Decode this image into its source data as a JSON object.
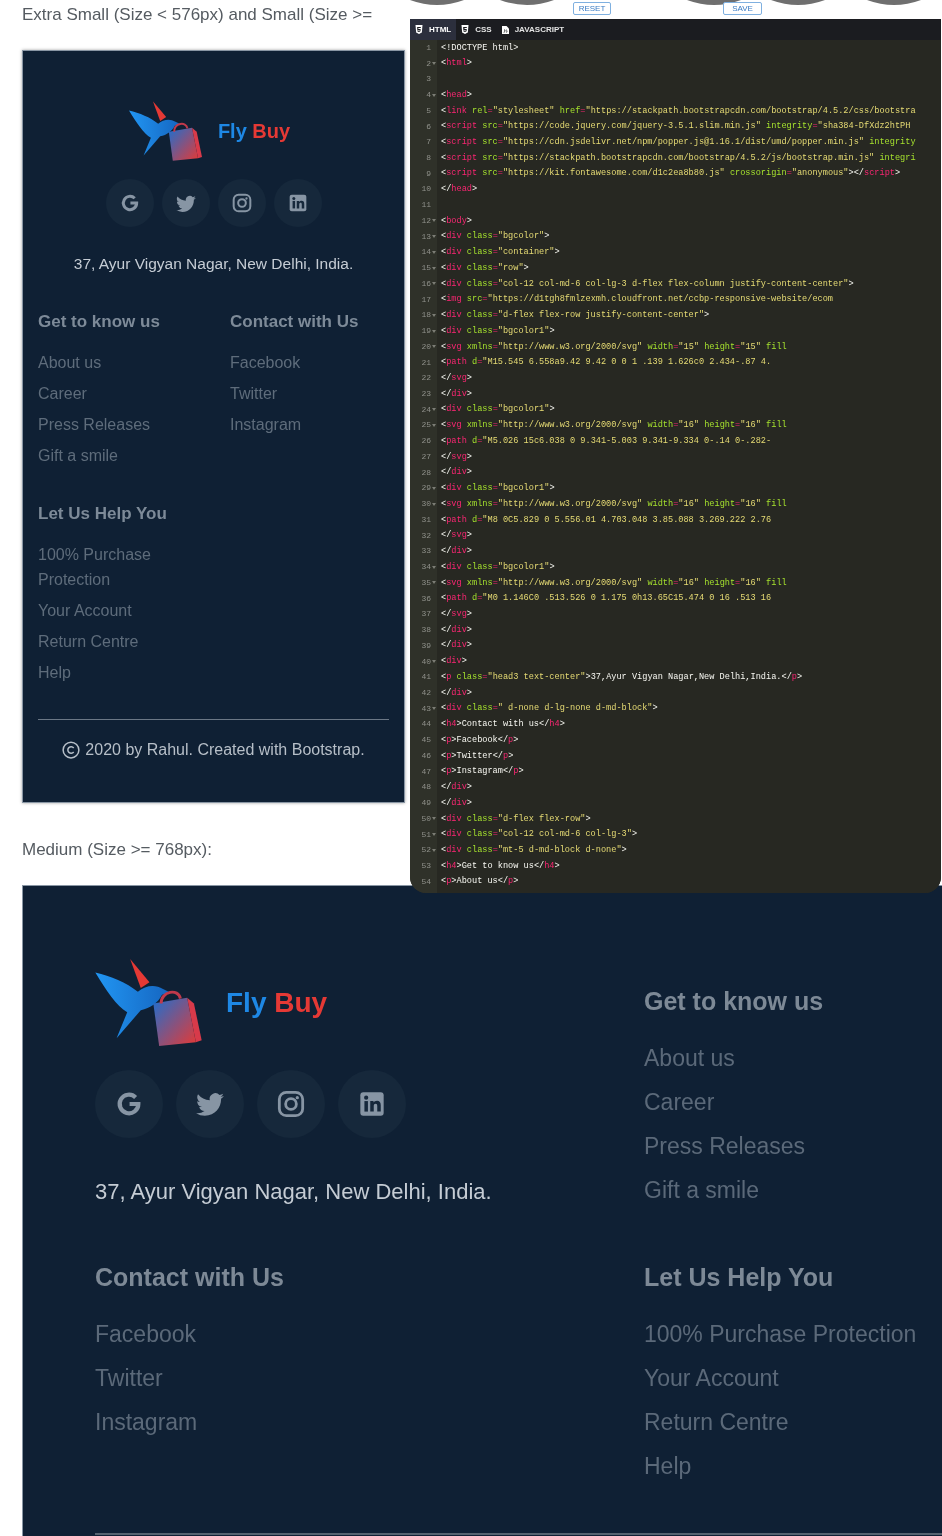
{
  "toolbar": {
    "buttons": [
      "RESET",
      "SAVE"
    ]
  },
  "previews": [
    {
      "kind": "compact",
      "label": "Extra Small (Size < 576px) and Small (Size >=",
      "footer": {
        "brand": "Fly Buy",
        "social_links": [
          {
            "kind": "g"
          },
          {
            "kind": "bird"
          },
          {
            "kind": "camera"
          },
          {
            "kind": "in"
          }
        ],
        "address": "37, Ayur Vigyan Nagar, New Delhi, India.",
        "columns": [
          {
            "sections": [
              {
                "heading": "Get to know us",
                "links": [
                  "About us",
                  "Career",
                  "Press Releases",
                  "Gift a smile"
                ]
              },
              {
                "heading": "Let Us Help You",
                "links": [
                  "100% Purchase Protection",
                  "Your Account",
                  "Return Centre",
                  "Help"
                ]
              }
            ]
          },
          {
            "sections": [
              {
                "heading": "Contact with Us",
                "links": [
                  "Facebook",
                  "Twitter",
                  "Instagram"
                ]
              }
            ]
          }
        ],
        "copyright": "2020 by Rahul. Created with Bootstrap."
      }
    },
    {
      "kind": "wide",
      "label": "Medium (Size >= 768px):",
      "footer": {
        "columns": [
          {
            "brand": "Fly Buy",
            "social_links": [
              {
                "kind": "g"
              },
              {
                "kind": "bird"
              },
              {
                "kind": "camera"
              },
              {
                "kind": "in"
              }
            ],
            "address": "37, Ayur Vigyan Nagar, New Delhi, India.",
            "sections": [
              {
                "heading": "Contact with Us",
                "links": [
                  "Facebook",
                  "Twitter",
                  "Instagram"
                ]
              }
            ]
          },
          {
            "sections": [
              {
                "heading": "Get to know us",
                "links": [
                  "About us",
                  "Career",
                  "Press Releases",
                  "Gift a smile"
                ]
              },
              {
                "heading": "Let Us Help You",
                "links": [
                  "100% Purchase Protection",
                  "Your Account",
                  "Return Centre",
                  "Help"
                ]
              }
            ]
          }
        ]
      }
    }
  ],
  "editor": {
    "tabs": [
      {
        "label": "HTML",
        "kind": "html",
        "selected": true
      },
      {
        "label": "CSS",
        "kind": "css",
        "selected": false
      },
      {
        "label": "JAVASCRIPT",
        "kind": "js",
        "selected": false
      }
    ],
    "lines": [
      {
        "number": "1",
        "text": "<!DOCTYPE html>",
        "foldable": false
      },
      {
        "number": "2",
        "text": "<html>",
        "foldable": true
      },
      {
        "number": "3",
        "foldable": false
      },
      {
        "number": "4",
        "text": "<head>",
        "foldable": true
      },
      {
        "number": "5",
        "text": "    <link rel=\"stylesheet\" href=\"https://stackpath.bootstrapcdn.com/bootstrap/4.5.2/css/bootstra",
        "foldable": false
      },
      {
        "number": "6",
        "text": "    <script src=\"https://code.jquery.com/jquery-3.5.1.slim.min.js\" integrity=\"sha384-DfXdz2htPH",
        "foldable": false
      },
      {
        "number": "7",
        "text": "    <script src=\"https://cdn.jsdelivr.net/npm/popper.js@1.16.1/dist/umd/popper.min.js\" integrity",
        "foldable": false
      },
      {
        "number": "8",
        "text": "    <script src=\"https://stackpath.bootstrapcdn.com/bootstrap/4.5.2/js/bootstrap.min.js\" integri",
        "foldable": false
      },
      {
        "number": "9",
        "text": "    <script src=\"https://kit.fontawesome.com/d1c2ea8b80.js\" crossorigin=\"anonymous\"></script>",
        "foldable": false
      },
      {
        "number": "10",
        "text": "</head>",
        "foldable": false
      },
      {
        "number": "11",
        "foldable": false
      },
      {
        "number": "12",
        "text": "<body>",
        "foldable": true
      },
      {
        "number": "13",
        "text": "    <div class=\"bgcolor\">",
        "foldable": true
      },
      {
        "number": "14",
        "text": "        <div class=\"container\">",
        "foldable": true
      },
      {
        "number": "15",
        "text": "            <div class=\"row\">",
        "foldable": true
      },
      {
        "number": "16",
        "text": "                <div class=\"col-12 col-md-6 col-lg-3 d-flex flex-column justify-content-center\">",
        "foldable": true
      },
      {
        "number": "17",
        "text": "                    <img src=\"https://d1tgh8fmlzexmh.cloudfront.net/ccbp-responsive-website/ecom",
        "foldable": false
      },
      {
        "number": "18",
        "text": "                    <div class=\"d-flex flex-row justify-content-center\">",
        "foldable": true
      },
      {
        "number": "19",
        "text": "                        <div class=\"bgcolor1\">",
        "foldable": true
      },
      {
        "number": "20",
        "text": "                            <svg xmlns=\"http://www.w3.org/2000/svg\" width=\"15\" height=\"15\" fill",
        "foldable": true
      },
      {
        "number": "21",
        "text": "                                <path d=\"M15.545 6.558a9.42 9.42 0 0 1 .139 1.626c0 2.434-.87 4.",
        "foldable": false
      },
      {
        "number": "22",
        "text": "                            </svg>",
        "foldable": false
      },
      {
        "number": "23",
        "text": "                        </div>",
        "foldable": false
      },
      {
        "number": "24",
        "text": "                        <div class=\"bgcolor1\">",
        "foldable": true
      },
      {
        "number": "25",
        "text": "                            <svg xmlns=\"http://www.w3.org/2000/svg\" width=\"16\" height=\"16\" fill",
        "foldable": true
      },
      {
        "number": "26",
        "text": "                                <path d=\"M5.026 15c6.038 0 9.341-5.003 9.341-9.334 0-.14 0-.282-",
        "foldable": false
      },
      {
        "number": "27",
        "text": "                            </svg>",
        "foldable": false
      },
      {
        "number": "28",
        "text": "                        </div>",
        "foldable": false
      },
      {
        "number": "29",
        "text": "                        <div class=\"bgcolor1\">",
        "foldable": true
      },
      {
        "number": "30",
        "text": "                            <svg xmlns=\"http://www.w3.org/2000/svg\" width=\"16\" height=\"16\" fill",
        "foldable": true
      },
      {
        "number": "31",
        "text": "                                <path d=\"M8 0C5.829 0 5.556.01 4.703.048 3.85.088 3.269.222 2.76",
        "foldable": false
      },
      {
        "number": "32",
        "text": "                            </svg>",
        "foldable": false
      },
      {
        "number": "33",
        "text": "                        </div>",
        "foldable": false
      },
      {
        "number": "34",
        "text": "                        <div class=\"bgcolor1\">",
        "foldable": true
      },
      {
        "number": "35",
        "text": "                            <svg xmlns=\"http://www.w3.org/2000/svg\" width=\"16\" height=\"16\" fill",
        "foldable": true
      },
      {
        "number": "36",
        "text": "                                <path d=\"M0 1.146C0 .513.526 0 1.175 0h13.65C15.474 0 16 .513 16",
        "foldable": false
      },
      {
        "number": "37",
        "text": "                            </svg>",
        "foldable": false
      },
      {
        "number": "38",
        "text": "                        </div>",
        "foldable": false
      },
      {
        "number": "39",
        "text": "                    </div>",
        "foldable": false
      },
      {
        "number": "40",
        "text": "                    <div>",
        "foldable": true
      },
      {
        "number": "41",
        "text": "                        <p class=\"head3 text-center\">37,Ayur Vigyan Nagar,New Delhi,India.</p>",
        "foldable": false
      },
      {
        "number": "42",
        "text": "                    </div>",
        "foldable": false
      },
      {
        "number": "43",
        "text": "                    <div class=\" d-none d-lg-none d-md-block\">",
        "foldable": true
      },
      {
        "number": "44",
        "text": "                        <h4>Contact with us</h4>",
        "foldable": false
      },
      {
        "number": "45",
        "text": "                        <p>Facebook</p>",
        "foldable": false
      },
      {
        "number": "46",
        "text": "                        <p>Twitter</p>",
        "foldable": false
      },
      {
        "number": "47",
        "text": "                        <p>Instagram</p>",
        "foldable": false
      },
      {
        "number": "48",
        "text": "                    </div>",
        "foldable": false
      },
      {
        "number": "49",
        "text": "                </div>",
        "foldable": false
      },
      {
        "number": "50",
        "text": "                <div class=\"d-flex flex-row\">",
        "foldable": true
      },
      {
        "number": "51",
        "text": "                    <div class=\"col-12 col-md-6 col-lg-3\">",
        "foldable": true
      },
      {
        "number": "52",
        "text": "                        <div class=\"mt-5 d-md-block d-none\">",
        "foldable": true
      },
      {
        "number": "53",
        "text": "                            <h4>Get to know us</h4>",
        "foldable": false
      },
      {
        "number": "54",
        "text": "                            <p>About us</p>",
        "foldable": false
      }
    ]
  }
}
